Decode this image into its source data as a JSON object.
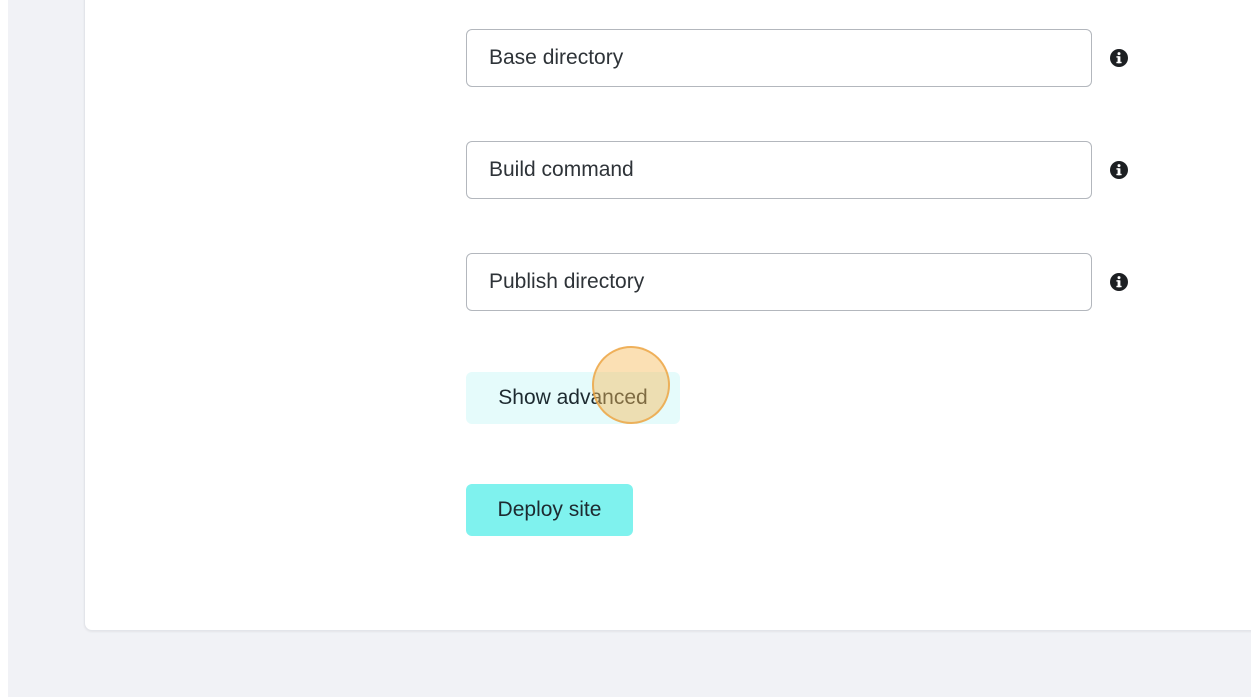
{
  "form": {
    "fields": [
      {
        "placeholder": "Base directory",
        "value": "",
        "info_icon": "info-circle-icon"
      },
      {
        "placeholder": "Build command",
        "value": "",
        "info_icon": "info-circle-icon"
      },
      {
        "placeholder": "Publish directory",
        "value": "",
        "info_icon": "info-circle-icon"
      }
    ],
    "show_advanced_label": "Show advanced",
    "deploy_label": "Deploy site"
  },
  "colors": {
    "page_background": "#f1f2f6",
    "card_background": "#ffffff",
    "input_border": "#b3b7bd",
    "secondary_button": "#e5fbfb",
    "primary_button": "#7ff2ee",
    "text": "#1d2a30",
    "click_marker": "#f7ba58"
  }
}
